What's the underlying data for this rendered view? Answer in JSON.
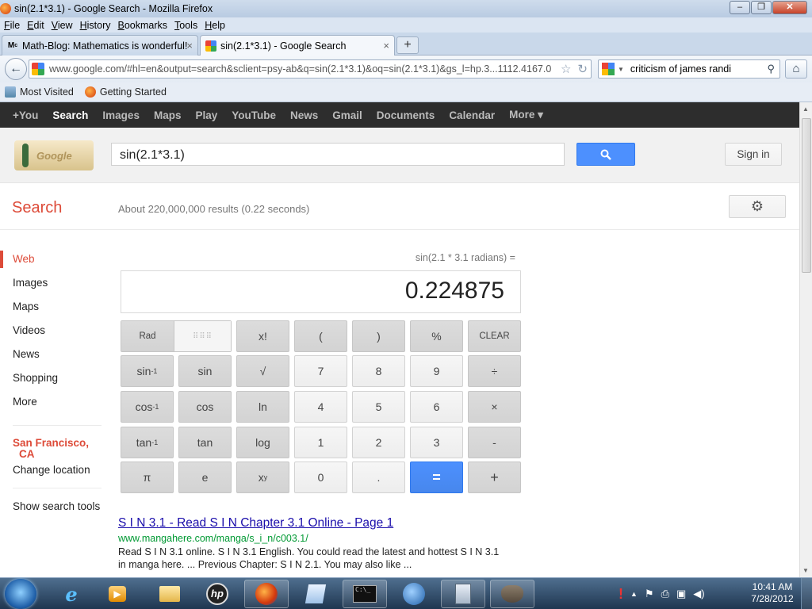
{
  "window": {
    "title": "sin(2.1*3.1) - Google Search - Mozilla Firefox",
    "menu": [
      "File",
      "Edit",
      "View",
      "History",
      "Bookmarks",
      "Tools",
      "Help"
    ]
  },
  "tabs": [
    {
      "label": "Math-Blog: Mathematics is wonderful!",
      "icon": "math-blog-icon",
      "active": false
    },
    {
      "label": "sin(2.1*3.1) - Google Search",
      "icon": "google-favicon-icon",
      "active": true
    }
  ],
  "navbar": {
    "url": "www.google.com/#hl=en&output=search&sclient=psy-ab&q=sin(2.1*3.1)&oq=sin(2.1*3.1)&gs_l=hp.3...1112.4167.0",
    "search_query": "criticism of james randi"
  },
  "bookmarks": [
    {
      "label": "Most Visited",
      "icon": "most-visited-icon"
    },
    {
      "label": "Getting Started",
      "icon": "firefox-icon"
    }
  ],
  "google_bar": {
    "items": [
      "+You",
      "Search",
      "Images",
      "Maps",
      "Play",
      "YouTube",
      "News",
      "Gmail",
      "Documents",
      "Calendar",
      "More ▾"
    ],
    "current": "Search"
  },
  "header": {
    "doodle_text": "Google",
    "query": "sin(2.1*3.1)",
    "sign_in": "Sign in"
  },
  "results_bar": {
    "label": "Search",
    "stats": "About 220,000,000 results (0.22 seconds)"
  },
  "left_nav": {
    "items": [
      "Web",
      "Images",
      "Maps",
      "Videos",
      "News",
      "Shopping",
      "More"
    ],
    "selected": "Web",
    "location_city": "San Francisco,",
    "location_state": "CA",
    "change_location": "Change location",
    "search_tools": "Show search tools"
  },
  "calculator": {
    "expression": "sin(2.1 * 3.1 radians) =",
    "result": "0.224875",
    "keys": {
      "rad": "Rad",
      "fact": "x!",
      "lparen": "(",
      "rparen": ")",
      "pct": "%",
      "clear": "CLEAR",
      "sin_inv": "sin",
      "sin": "sin",
      "sqrt": "√",
      "k7": "7",
      "k8": "8",
      "k9": "9",
      "div": "÷",
      "cos_inv": "cos",
      "cos": "cos",
      "ln": "ln",
      "k4": "4",
      "k5": "5",
      "k6": "6",
      "mul": "×",
      "tan_inv": "tan",
      "tan": "tan",
      "log": "log",
      "k1": "1",
      "k2": "2",
      "k3": "3",
      "sub": "-",
      "pi": "π",
      "e": "e",
      "pow": "x",
      "k0": "0",
      "dot": ".",
      "eq": "=",
      "add": "+",
      "inv_sup": "-1",
      "pow_sup": "y"
    }
  },
  "result": {
    "title": "S I N 3.1 - Read S I N Chapter 3.1 Online - Page 1",
    "url": "www.mangahere.com/manga/s_i_n/c003.1/",
    "snippet1": "Read S I N 3.1 online. S I N 3.1 English. You could read the latest and hottest S I N 3.1",
    "snippet2": "in manga here. ... Previous Chapter: S I N 2.1. You may also like ..."
  },
  "taskbar": {
    "time": "10:41 AM",
    "date": "7/28/2012"
  }
}
